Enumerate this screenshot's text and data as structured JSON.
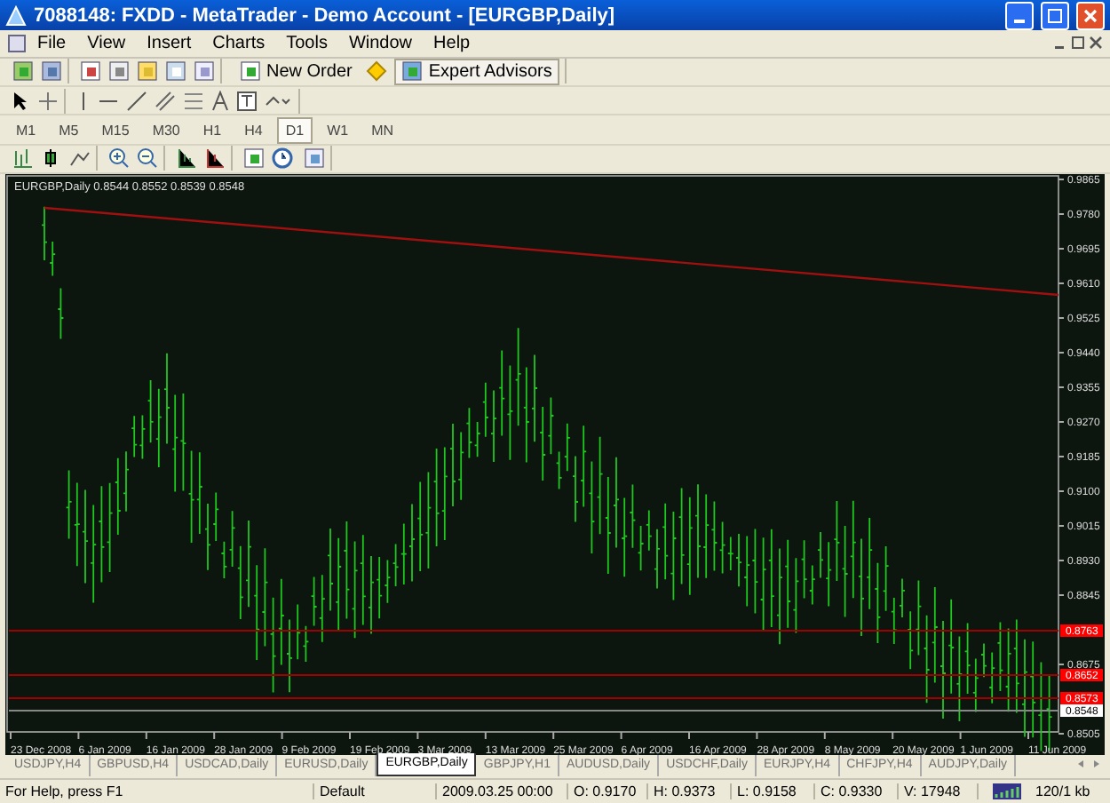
{
  "window": {
    "title": "7088148: FXDD - MetaTrader - Demo Account - [EURGBP,Daily]"
  },
  "menu": [
    "File",
    "View",
    "Insert",
    "Charts",
    "Tools",
    "Window",
    "Help"
  ],
  "toolbar": {
    "new_order": "New Order",
    "expert_advisors": "Expert Advisors"
  },
  "timeframes": [
    {
      "label": "M1",
      "selected": false
    },
    {
      "label": "M5",
      "selected": false
    },
    {
      "label": "M15",
      "selected": false
    },
    {
      "label": "M30",
      "selected": false
    },
    {
      "label": "H1",
      "selected": false
    },
    {
      "label": "H4",
      "selected": false
    },
    {
      "label": "D1",
      "selected": true
    },
    {
      "label": "W1",
      "selected": false
    },
    {
      "label": "MN",
      "selected": false
    }
  ],
  "chart": {
    "info": "EURGBP,Daily  0.8544 0.8552 0.8539 0.8548",
    "price_labels": [
      "0.9865",
      "0.9780",
      "0.9695",
      "0.9610",
      "0.9525",
      "0.9440",
      "0.9355",
      "0.9270",
      "0.9185",
      "0.9100",
      "0.9015",
      "0.8930",
      "0.8845",
      "0.8675",
      "0.8505"
    ],
    "level_lines": [
      {
        "label": "0.8763",
        "color": "#ff0000"
      },
      {
        "label": "0.8652",
        "color": "#ff0000"
      },
      {
        "label": "0.8573",
        "color": "#ff0000"
      },
      {
        "label": "0.8548",
        "color": "#ffffff"
      }
    ],
    "date_labels": [
      "23 Dec 2008",
      "6 Jan 2009",
      "16 Jan 2009",
      "28 Jan 2009",
      "9 Feb 2009",
      "19 Feb 2009",
      "3 Mar 2009",
      "13 Mar 2009",
      "25 Mar 2009",
      "6 Apr 2009",
      "16 Apr 2009",
      "28 Apr 2009",
      "8 May 2009",
      "20 May 2009",
      "1 Jun 2009",
      "11 Jun 2009"
    ]
  },
  "tabs": [
    {
      "label": "USDJPY,H4",
      "selected": false
    },
    {
      "label": "GBPUSD,H4",
      "selected": false
    },
    {
      "label": "USDCAD,Daily",
      "selected": false
    },
    {
      "label": "EURUSD,Daily",
      "selected": false
    },
    {
      "label": "EURGBP,Daily",
      "selected": true
    },
    {
      "label": "GBPJPY,H1",
      "selected": false
    },
    {
      "label": "AUDUSD,Daily",
      "selected": false
    },
    {
      "label": "USDCHF,Daily",
      "selected": false
    },
    {
      "label": "EURJPY,H4",
      "selected": false
    },
    {
      "label": "CHFJPY,H4",
      "selected": false
    },
    {
      "label": "AUDJPY,Daily",
      "selected": false
    }
  ],
  "status_bar": {
    "help": "For Help, press F1",
    "profile": "Default",
    "time": "2009.03.25 00:00",
    "open": "O: 0.9170",
    "high": "H: 0.9373",
    "low": "L: 0.9158",
    "close": "C: 0.9330",
    "volume": "V: 17948",
    "traffic": "120/1 kb"
  }
}
